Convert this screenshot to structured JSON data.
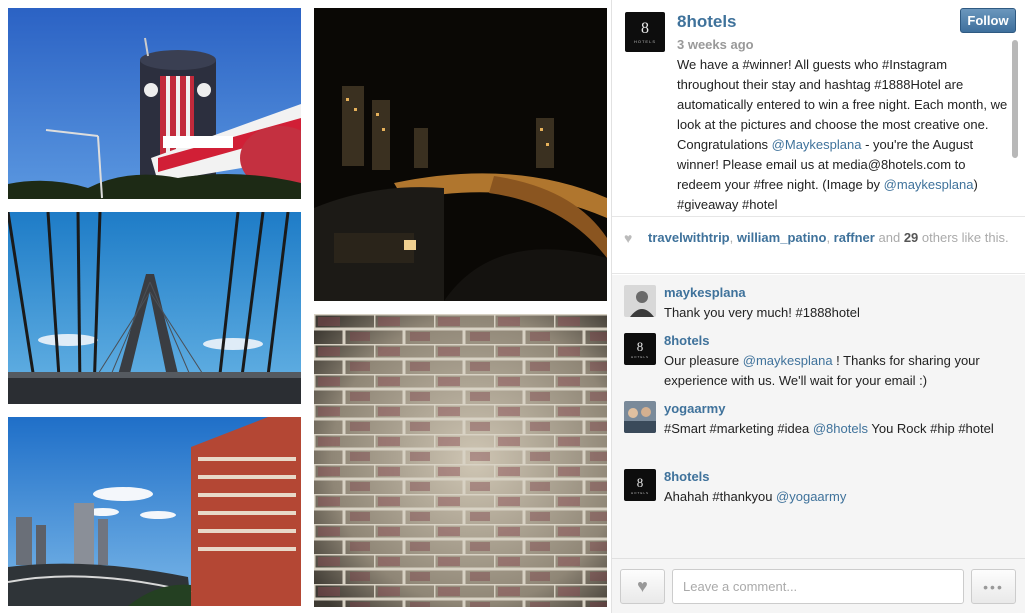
{
  "photos": [
    {
      "description_icon": "bunnings-clock-tower-photo"
    },
    {
      "description_icon": "anzac-bridge-photo"
    },
    {
      "description_icon": "city-freeway-building-photo"
    },
    {
      "description_icon": "night-city-freeway-photo"
    },
    {
      "description_icon": "brick-wall-photo"
    }
  ],
  "post": {
    "author": "8hotels",
    "time": "3 weeks ago",
    "follow_label": "Follow",
    "avatar_number": "8",
    "avatar_caption": "HOTELS",
    "caption_parts": [
      {
        "text": "We have a #winner! All guests who #Instagram throughout their stay and hashtag #1888Hotel are automatically entered to win a free night. Each month, we look at the pictures and choose the most creative one. Congratulations ",
        "mention": false
      },
      {
        "text": "@Maykesplana",
        "mention": true
      },
      {
        "text": " - you're the August winner! Please email us at media@8hotels.com to redeem your #free night. (Image by ",
        "mention": false
      },
      {
        "text": "@maykesplana",
        "mention": true
      },
      {
        "text": ") #giveaway #hotel",
        "mention": false
      }
    ]
  },
  "likes": {
    "users": [
      "travelwithtrip",
      "william_patino",
      "raffner"
    ],
    "and_text": "and",
    "count": "29",
    "suffix": "others like this."
  },
  "comments": [
    {
      "user": "maykesplana",
      "avatar": "person-photo",
      "parts": [
        {
          "text": "Thank you very much! #1888hotel",
          "mention": false
        }
      ]
    },
    {
      "user": "8hotels",
      "avatar": "8hotels-logo",
      "parts": [
        {
          "text": "Our pleasure ",
          "mention": false
        },
        {
          "text": "@maykesplana",
          "mention": true
        },
        {
          "text": " ! Thanks for sharing your experience with us. We'll wait for your email :)",
          "mention": false
        }
      ]
    },
    {
      "user": "yogaarmy",
      "avatar": "group-photo",
      "parts": [
        {
          "text": "#Smart #marketing #idea ",
          "mention": false
        },
        {
          "text": "@8hotels",
          "mention": true
        },
        {
          "text": " You Rock #hip #hotel",
          "mention": false
        }
      ]
    },
    {
      "user": "8hotels",
      "avatar": "8hotels-logo",
      "parts": [
        {
          "text": "Ahahah #thankyou ",
          "mention": false
        },
        {
          "text": "@yogaarmy",
          "mention": true
        }
      ]
    }
  ],
  "footer": {
    "comment_placeholder": "Leave a comment...",
    "more_label": "•••"
  },
  "colors": {
    "link": "#3f729b",
    "follow_button": "#4d7fa9",
    "panel_bg": "#f5f5f5"
  }
}
